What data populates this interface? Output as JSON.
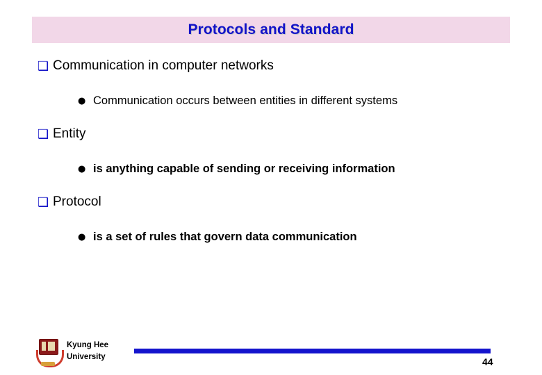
{
  "slide": {
    "title": "Protocols and Standard",
    "bullets": [
      {
        "marker": "❑",
        "text": "Communication in computer networks",
        "children": [
          {
            "marker": "●",
            "text": "Communication occurs between entities in different systems"
          }
        ]
      },
      {
        "marker": "❑",
        "text": "Entity",
        "children": [
          {
            "marker": "●",
            "text": "is anything capable of sending or receiving information"
          }
        ]
      },
      {
        "marker": "❑",
        "text": "Protocol",
        "children": [
          {
            "marker": "●",
            "text": "is a set of rules that govern data communication"
          }
        ]
      }
    ]
  },
  "footer": {
    "organization_line1": "Kyung Hee",
    "organization_line2": "University",
    "page_number": "44"
  },
  "colors": {
    "title_banner_bg": "#f2d7e8",
    "title_text": "#1313c8",
    "bullet_marker": "#1313c8",
    "footer_rule": "#1414cd"
  }
}
